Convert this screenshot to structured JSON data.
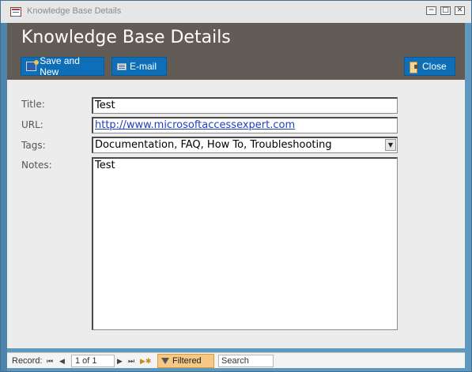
{
  "window": {
    "title": "Knowledge Base Details",
    "controls": [
      "−",
      "□",
      "✕"
    ]
  },
  "header": {
    "title": "Knowledge Base Details",
    "buttons": {
      "save_new": "Save and New",
      "email": "E-mail",
      "close": "Close"
    }
  },
  "form": {
    "title_label": "Title:",
    "title_value": "Test",
    "url_label": "URL:",
    "url_value": "http://www.microsoftaccessexpert.com",
    "tags_label": "Tags:",
    "tags_value": "Documentation, FAQ, How To, Troubleshooting",
    "notes_label": "Notes:",
    "notes_value": "Test"
  },
  "navbar": {
    "record_label": "Record:",
    "first": "⏮",
    "prev": "◀",
    "record_value": "1 of 1",
    "next": "▶",
    "last": "⏭",
    "new": "▶✱",
    "filter_label": "Filtered",
    "search_placeholder": "Search"
  },
  "colors": {
    "header_bg": "#635b56",
    "button_bg": "#0e6fb8",
    "window_frame": "#5f98bf",
    "filter_bg": "#f5c985"
  },
  "icons": {
    "app": "access-form-icon",
    "save_new": "save-new-icon",
    "email": "email-icon",
    "close": "close-door-icon",
    "filter": "filter-icon",
    "dropdown": "chevron-down-icon"
  }
}
